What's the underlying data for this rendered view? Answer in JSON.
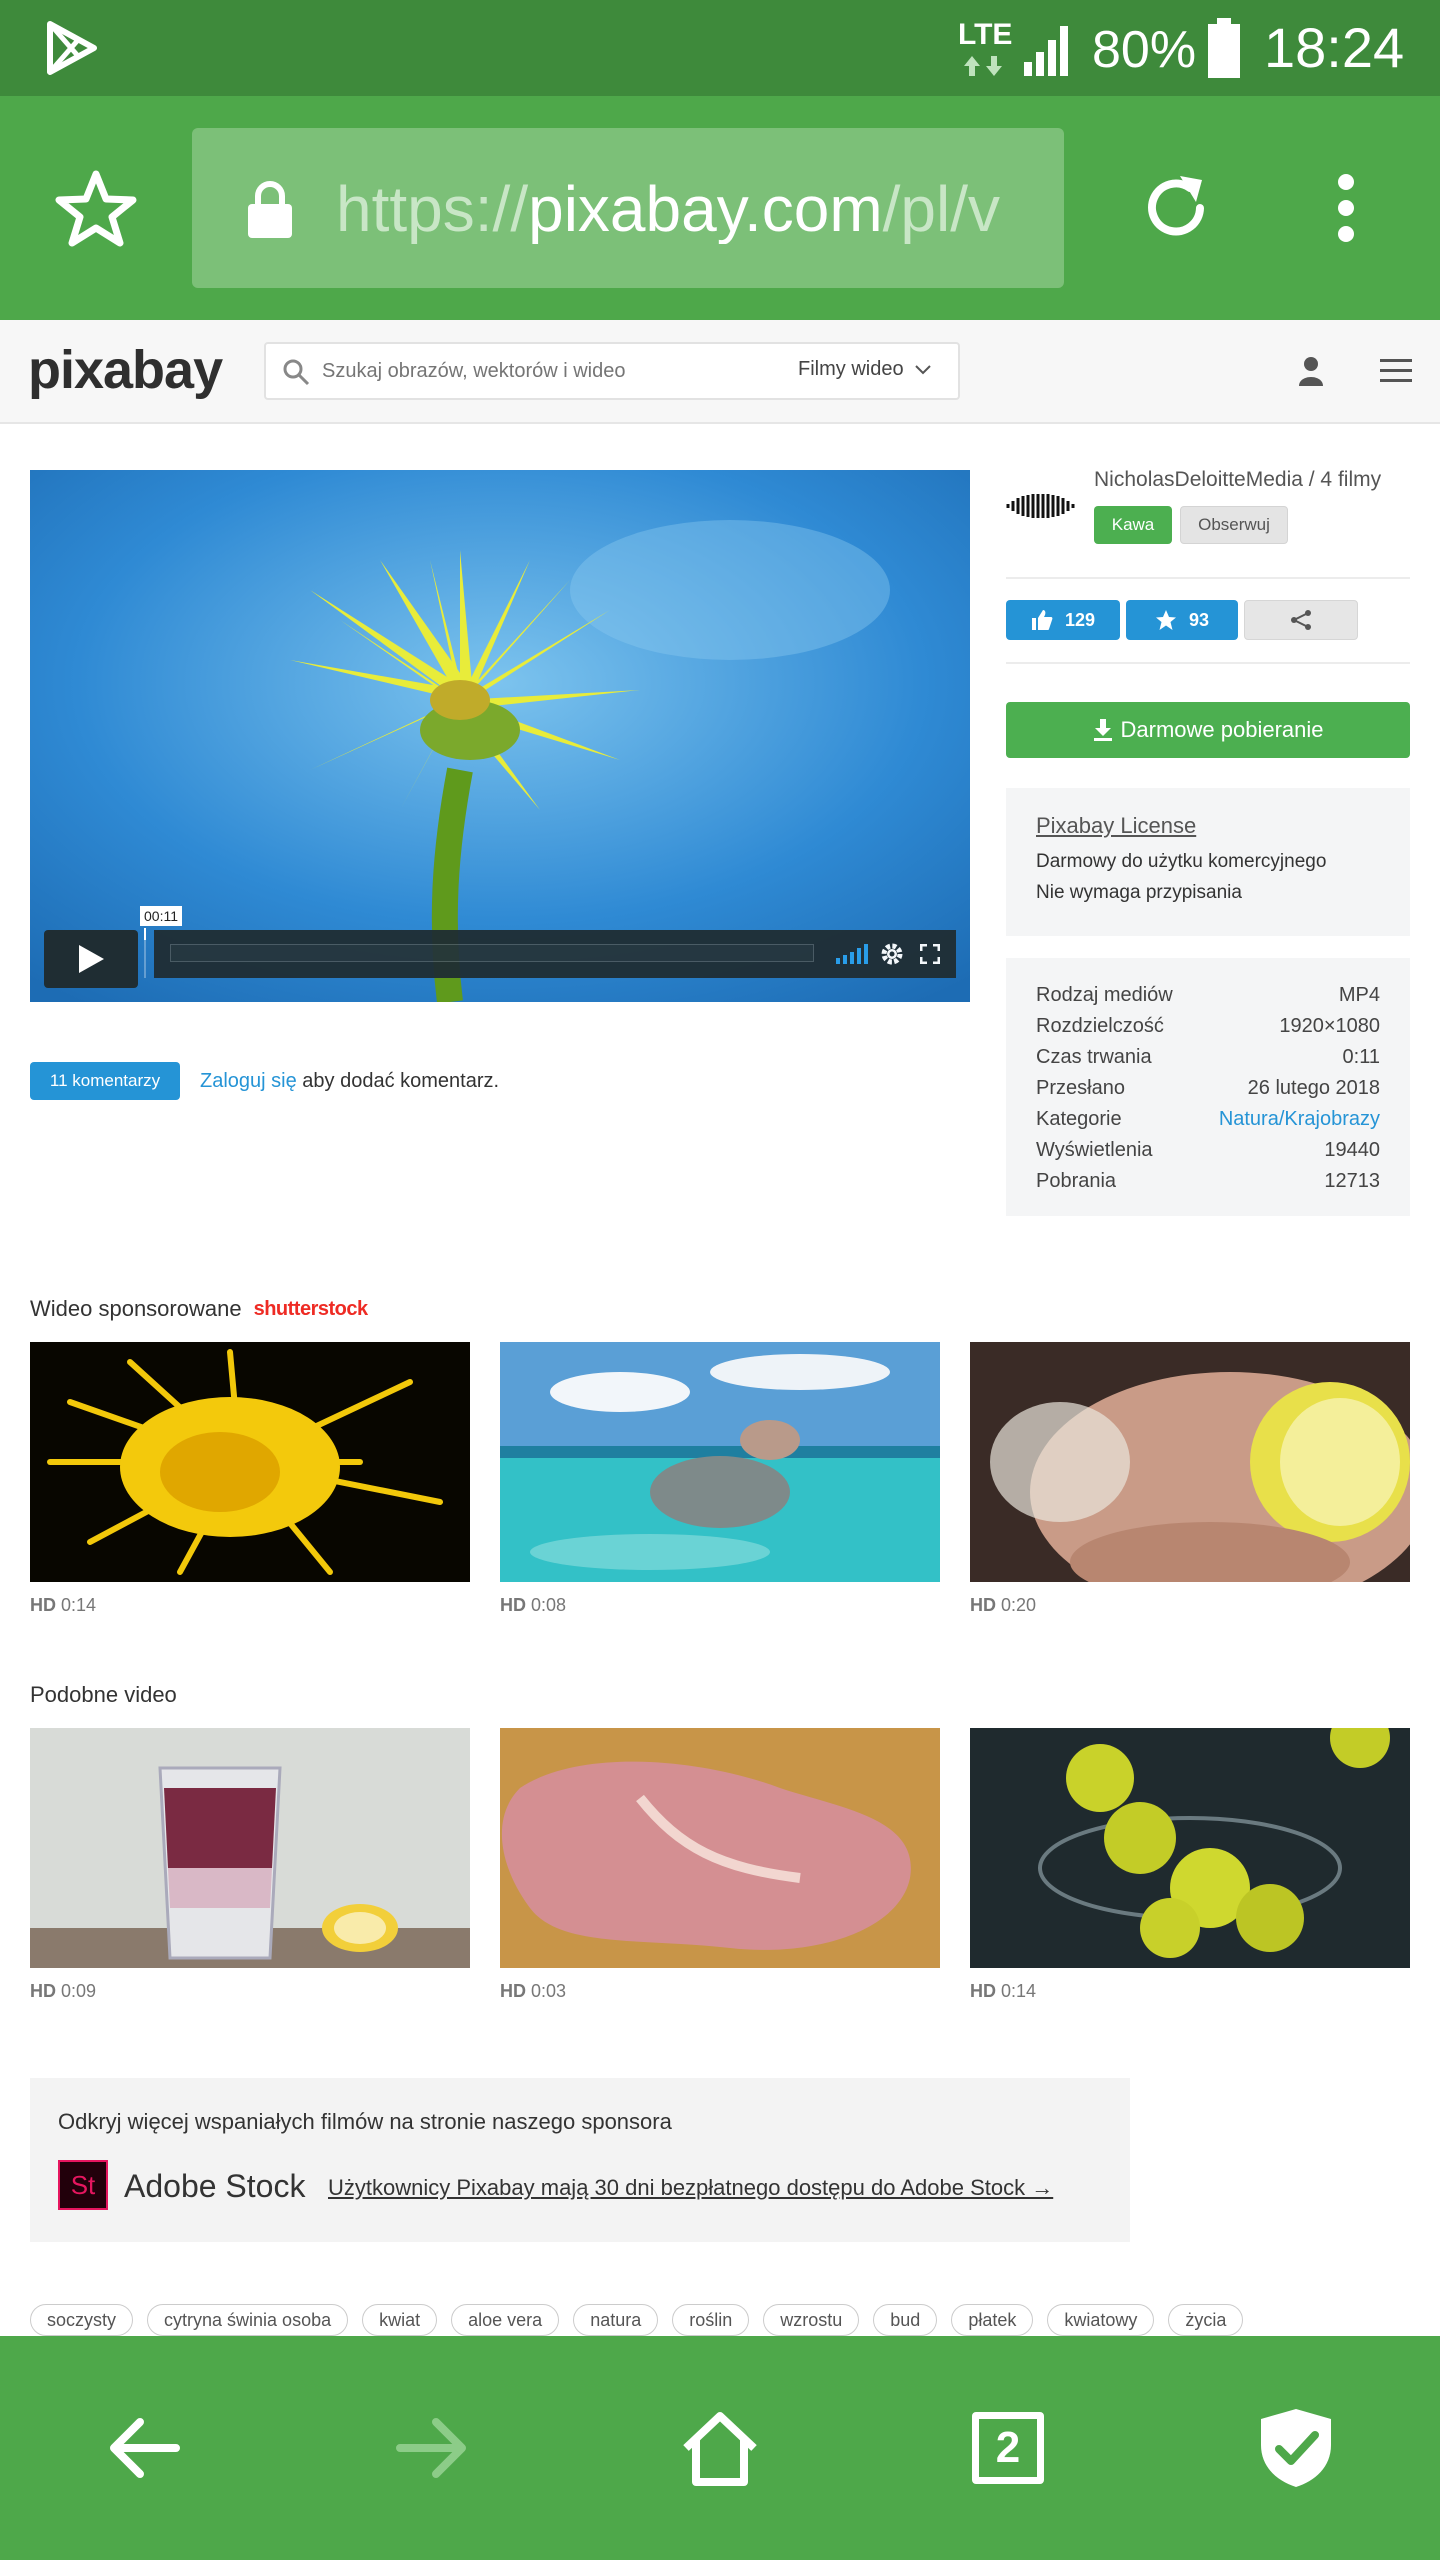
{
  "status_bar": {
    "network": "LTE",
    "battery": "80%",
    "time": "18:24"
  },
  "browser": {
    "url_prefix": "https://",
    "url_host": "pixabay.com",
    "url_path": "/pl/v",
    "tab_count": "2"
  },
  "header": {
    "logo": "pixabay",
    "search_placeholder": "Szukaj obrazów, wektorów i wideo",
    "search_type": "Filmy wideo"
  },
  "video": {
    "timestamp": "00:11"
  },
  "author": {
    "name_line": "NicholasDeloitteMedia / 4 filmy",
    "coffee_label": "Kawa",
    "follow_label": "Obserwuj"
  },
  "actions": {
    "likes": "129",
    "favorites": "93",
    "download_label": "Darmowe pobieranie"
  },
  "license": {
    "title": "Pixabay License",
    "line1": "Darmowy do użytku komercyjnego",
    "line2": "Nie wymaga przypisania"
  },
  "info": [
    {
      "label": "Rodzaj mediów",
      "value": "MP4"
    },
    {
      "label": "Rozdzielczość",
      "value": "1920×1080"
    },
    {
      "label": "Czas trwania",
      "value": "0:11"
    },
    {
      "label": "Przesłano",
      "value": "26 lutego 2018"
    },
    {
      "label": "Kategorie",
      "value": "Natura/Krajobrazy"
    },
    {
      "label": "Wyświetlenia",
      "value": "19440"
    },
    {
      "label": "Pobrania",
      "value": "12713"
    }
  ],
  "comments": {
    "count_label": "11 komentarzy",
    "login_link": "Zaloguj się",
    "login_text": " aby dodać komentarz."
  },
  "sponsored": {
    "title": "Wideo sponsorowane",
    "brand": "shutterstock",
    "items": [
      {
        "quality": "HD",
        "duration": "0:14"
      },
      {
        "quality": "HD",
        "duration": "0:08"
      },
      {
        "quality": "HD",
        "duration": "0:20"
      }
    ]
  },
  "similar": {
    "title": "Podobne video",
    "items": [
      {
        "quality": "HD",
        "duration": "0:09"
      },
      {
        "quality": "HD",
        "duration": "0:03"
      },
      {
        "quality": "HD",
        "duration": "0:14"
      }
    ]
  },
  "sponsor_box": {
    "heading": "Odkryj więcej wspaniałych filmów na stronie naszego sponsora",
    "logo_letters": "St",
    "brand": "Adobe Stock",
    "link": "Użytkownicy Pixabay mają 30 dni bezpłatnego dostępu do Adobe Stock →"
  },
  "tags": [
    "soczysty",
    "cytryna świnia osoba",
    "kwiat",
    "aloe vera",
    "natura",
    "roślin",
    "wzrostu",
    "bud",
    "płatek",
    "kwiatowy",
    "życia"
  ],
  "colors": {
    "browser_green": "#4ea84a",
    "status_green": "#3e8a3b",
    "pixabay_green": "#4caf50",
    "link_blue": "#2594d6",
    "like_blue": "#2594d6",
    "shutterstock_red": "#ee2b24",
    "adobe_pink": "#e5165f"
  }
}
